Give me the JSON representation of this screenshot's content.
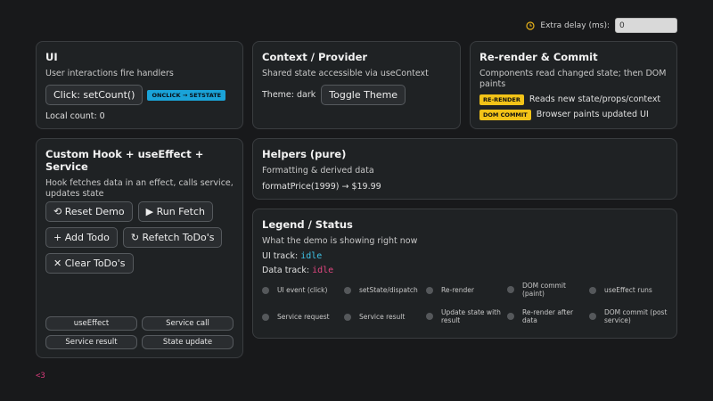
{
  "topbar": {
    "delay_label": "Extra delay (ms):",
    "delay_value": "0"
  },
  "ui_card": {
    "title": "UI",
    "subtitle": "User interactions fire handlers",
    "button_label": "Click: setCount()",
    "badge": "ONCLICK → SETSTATE",
    "local_count": "Local count: 0"
  },
  "context_card": {
    "title": "Context / Provider",
    "subtitle": "Shared state accessible via useContext",
    "theme_label": "Theme: dark",
    "toggle_label": "Toggle Theme"
  },
  "rerender_card": {
    "title": "Re-render & Commit",
    "subtitle": "Components read changed state; then DOM paints",
    "rows": [
      {
        "badge": "RE-RENDER",
        "text": "Reads new state/props/context"
      },
      {
        "badge": "DOM COMMIT",
        "text": "Browser paints updated UI"
      }
    ]
  },
  "hook_card": {
    "title": "Custom Hook + useEffect + Service",
    "subtitle": "Hook fetches data in an effect, calls service, updates state",
    "buttons": [
      "⟲ Reset Demo",
      "▶ Run Fetch",
      "+ Add Todo",
      "↻ Refetch ToDo's",
      "✕ Clear ToDo's"
    ],
    "pills": [
      "useEffect",
      "Service call",
      "Service result",
      "State update"
    ]
  },
  "helpers_card": {
    "title": "Helpers (pure)",
    "subtitle": "Formatting & derived data",
    "example": "formatPrice(1999) → $19.99"
  },
  "legend_card": {
    "title": "Legend / Status",
    "subtitle": "What the demo is showing right now",
    "ui_track_label": "UI track:",
    "ui_track_value": "idle",
    "data_track_label": "Data track:",
    "data_track_value": "idle",
    "items": [
      "UI event (click)",
      "setState/dispatch",
      "Re-render",
      "DOM commit (paint)",
      "useEffect runs",
      "Service request",
      "Service result",
      "Update state with result",
      "Re-render after data",
      "DOM commit (post service)"
    ]
  },
  "footer": {
    "heart": "<3"
  },
  "colors": {
    "accent_blue": "#1aa3d8",
    "accent_yellow": "#f2c318",
    "code_cyan": "#3fc3e6",
    "code_pink": "#e0467f",
    "footer_pink": "#d63a7a"
  }
}
